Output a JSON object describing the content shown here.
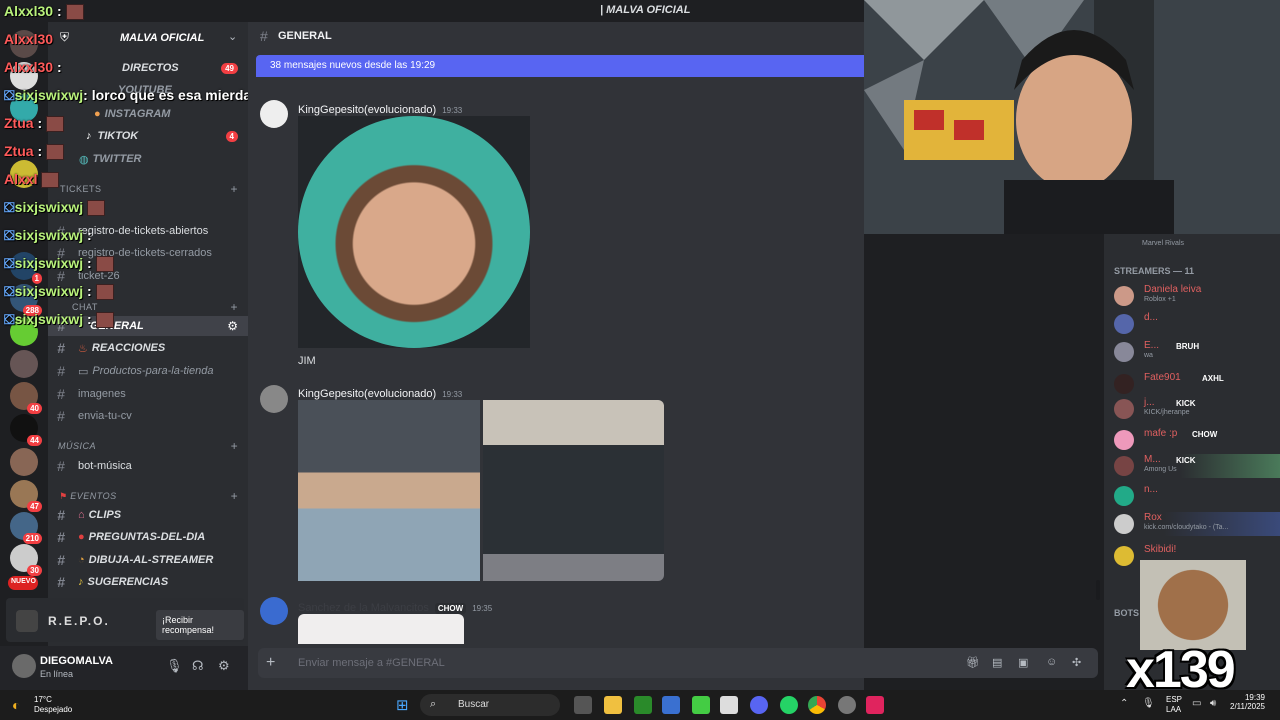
{
  "window": {
    "title": "| MALVA OFICIAL"
  },
  "server": {
    "name": "MALVA OFICIAL"
  },
  "channels": [
    {
      "name": "DIRECTOS",
      "badge": "49",
      "style": "bold"
    },
    {
      "name": "YOUTUBE",
      "badge": "",
      "style": "muted"
    },
    {
      "name": "INSTAGRAM",
      "badge": "",
      "style": "muted"
    },
    {
      "name": "TIKTOK",
      "badge": "4",
      "style": "bold"
    },
    {
      "name": "TWITTER",
      "badge": "",
      "style": "muted"
    },
    {
      "name": "TICKETS",
      "badge": "",
      "style": "cat"
    },
    {
      "name": "registro-de-tickets-abiertos",
      "badge": "",
      "style": "normal"
    },
    {
      "name": "registro-de-tickets-cerrados",
      "badge": "",
      "style": "muted"
    },
    {
      "name": "ticket-26",
      "badge": "",
      "style": "muted"
    },
    {
      "name": "CHAT",
      "badge": "",
      "style": "cat"
    },
    {
      "name": "GENERAL",
      "badge": "",
      "style": "active"
    },
    {
      "name": "REACCIONES",
      "badge": "",
      "style": "bold"
    },
    {
      "name": "Productos-para-la-tienda",
      "badge": "",
      "style": "muted"
    },
    {
      "name": "imagenes",
      "badge": "",
      "style": "normal"
    },
    {
      "name": "envia-tu-cv",
      "badge": "",
      "style": "normal"
    },
    {
      "name": "MÚSICA",
      "badge": "",
      "style": "cat"
    },
    {
      "name": "bot-música",
      "badge": "",
      "style": "normal"
    },
    {
      "name": "EVENTOS",
      "badge": "",
      "style": "cat"
    },
    {
      "name": "CLIPS",
      "badge": "",
      "style": "bold"
    },
    {
      "name": "PREGUNTAS-DEL-DIA",
      "badge": "",
      "style": "bold"
    },
    {
      "name": "DIBUJA-AL-STREAMER",
      "badge": "",
      "style": "bold"
    },
    {
      "name": "SUGERENCIAS",
      "badge": "",
      "style": "bold"
    }
  ],
  "server_badges": [
    "1",
    "288",
    "40",
    "44",
    "47",
    "210",
    "30",
    "NUEVO"
  ],
  "overlay_chat": [
    {
      "user": "Alxxl30",
      "text": ":"
    },
    {
      "user": "Alxxl30",
      "text": ""
    },
    {
      "user": "Alxxl30",
      "text": ":"
    },
    {
      "user": "sixjswixwj",
      "text": ": lorco que es esa mierda"
    },
    {
      "user": "Ztua",
      "text": ":"
    },
    {
      "user": "Ztua",
      "text": ":"
    },
    {
      "user": "Alxxl",
      "text": ""
    },
    {
      "user": "sixjswixwj",
      "text": ""
    },
    {
      "user": "sixjswixwj",
      "text": ":"
    },
    {
      "user": "sixjswixwj",
      "text": ":"
    },
    {
      "user": "sixjswixwj",
      "text": ":"
    },
    {
      "user": "sixjswixwj",
      "text": ":"
    }
  ],
  "promo": {
    "name": "R.E.P.O.",
    "button": "¡Recibir recompensa!"
  },
  "user": {
    "name": "DIEGOMALVA",
    "status": "En línea"
  },
  "channel_header": {
    "name": "GENERAL"
  },
  "new_messages": "38 mensajes nuevos desde las 19:29",
  "messages": [
    {
      "author": "KingGepesito(evolucionado)",
      "time": "19:33",
      "caption": "JIM",
      "tag": ""
    },
    {
      "author": "KingGepesito(evolucionado)",
      "time": "19:33",
      "caption": "",
      "tag": ""
    },
    {
      "author": "Sanchez de la Malvancitos",
      "time": "19:35",
      "caption": "",
      "tag": "CHOW"
    }
  ],
  "composer": {
    "placeholder": "Enviar mensaje a #GENERAL"
  },
  "members": {
    "top_activity": "Marvel Rivals",
    "section": "STREAMERS — 11",
    "list": [
      {
        "name": "Daniela leiva",
        "activity": "Roblox +1",
        "tag": ""
      },
      {
        "name": "d...",
        "activity": "",
        "tag": ""
      },
      {
        "name": "E...",
        "activity": "wa",
        "tag": "BRUH"
      },
      {
        "name": "Fate901",
        "activity": "",
        "tag": "AXHL"
      },
      {
        "name": "j...",
        "activity": "KICK/jheranpe",
        "tag": "KICK"
      },
      {
        "name": "mafe :p",
        "activity": "",
        "tag": "CHOW"
      },
      {
        "name": "M...",
        "activity": "Among Us",
        "tag": "KICK"
      },
      {
        "name": "n...",
        "activity": "",
        "tag": ""
      },
      {
        "name": "Rox",
        "activity": "kick.com/cloudytako - (Ta...",
        "tag": ""
      },
      {
        "name": "Skibidi!",
        "activity": "",
        "tag": ""
      }
    ],
    "bots_label": "BOTS"
  },
  "emote_counter": "x139",
  "taskbar": {
    "weather_temp": "17°C",
    "weather_desc": "Despejado",
    "search": "Buscar",
    "lang": "ESP",
    "lang2": "LAA",
    "time": "19:39",
    "date": "2/11/2025"
  }
}
